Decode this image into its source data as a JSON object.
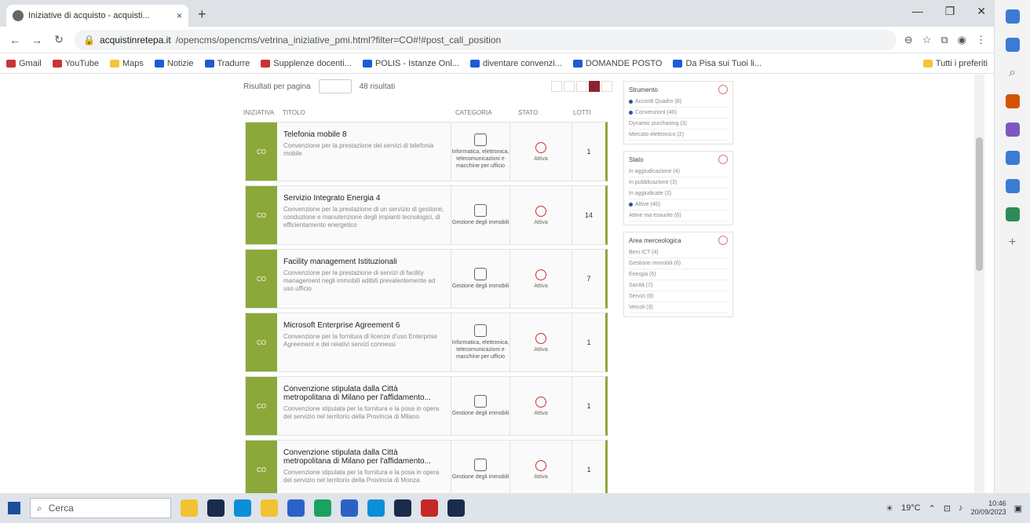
{
  "browser": {
    "tab_title": "Iniziative di acquisto - acquisti...",
    "tab_close": "×",
    "new_tab": "+",
    "url_domain": "acquistinretepa.it",
    "url_path": "/opencms/opencms/vetrina_iniziative_pmi.html?filter=CO#!#post_call_position",
    "bookmarks": [
      "Gmail",
      "YouTube",
      "Maps",
      "Notizie",
      "Tradurre",
      "Supplenze docenti...",
      "POLIS - Istanze Onl...",
      "diventare convenzi...",
      "DOMANDE POSTO",
      "Da Pisa sui Tuoi li..."
    ],
    "bookmarks_right": "Tutti i preferiti"
  },
  "toolbar": {
    "results_label": "Risultati per pagina",
    "count_label": "48 risultati"
  },
  "columns": {
    "col1": "INIZIATIVA",
    "col2": "TITOLO",
    "col3": "CATEGORIA",
    "col4": "STATO",
    "col5": "LOTTI"
  },
  "cards": [
    {
      "side": "CO",
      "title": "Telefonia mobile 8",
      "desc": "Convenzione per la prestazione dei servizi di telefonia mobile",
      "cat": "Informatica, elettronica, telecomunicazioni e macchine per ufficio",
      "status": "Attiva",
      "lots": "1"
    },
    {
      "side": "CO",
      "title": "Servizio Integrato Energia 4",
      "desc": "Convenzione per la prestazione di un servizio di gestione, conduzione e manutenzione degli impianti tecnologici, di efficientamento energetico",
      "cat": "Gestione degli immobili",
      "status": "Attiva",
      "lots": "14"
    },
    {
      "side": "CO",
      "title": "Facility management Istituzionali",
      "desc": "Convenzione per la prestazione di servizi di facility management negli immobili adibiti prevalentemente ad uso ufficio",
      "cat": "Gestione degli immobili",
      "status": "Attiva",
      "lots": "7"
    },
    {
      "side": "CO",
      "title": "Microsoft Enterprise Agreement 6",
      "desc": "Convenzione per la fornitura di licenze d'uso Enterprise Agreement e dei relativi servizi connessi",
      "cat": "Informatica, elettronica, telecomunicazioni e macchine per ufficio",
      "status": "Attiva",
      "lots": "1"
    },
    {
      "side": "CO",
      "title": "Convenzione stipulata dalla Città metropolitana di Milano per l'affidamento...",
      "desc": "Convenzione stipulata per la fornitura e la posa in opera del servizio nel territorio della Provincia di Milano",
      "cat": "Gestione degli immobili",
      "status": "Attiva",
      "lots": "1"
    },
    {
      "side": "CO",
      "title": "Convenzione stipulata dalla Città metropolitana di Milano per l'affidamento...",
      "desc": "Convenzione stipulata per la fornitura e la posa in opera del servizio nel territorio della Provincia di Monza",
      "cat": "Gestione degli immobili",
      "status": "Attiva",
      "lots": "1"
    }
  ],
  "filters": [
    {
      "title": "Strumento",
      "items": [
        "Accordi Quadro (8)",
        "Convenzioni (40)",
        "Dynamic purchasing (3)",
        "Mercato elettronico (2)"
      ]
    },
    {
      "title": "Stato",
      "items": [
        "In aggiudicazione (4)",
        "In pubblicazione (3)",
        "In aggiudicate (3)",
        "Attive (40)",
        "Attive ma esaurite (6)"
      ]
    },
    {
      "title": "Area merceologica",
      "items": [
        "Beni ICT (4)",
        "Gestione immobili (6)",
        "Energia (5)",
        "Sanità (7)",
        "Servizi (8)",
        "Veicoli (3)"
      ]
    }
  ],
  "taskbar": {
    "search_placeholder": "Cerca",
    "weather": "19°C",
    "time": "10:46",
    "date": "20/09/2023"
  }
}
